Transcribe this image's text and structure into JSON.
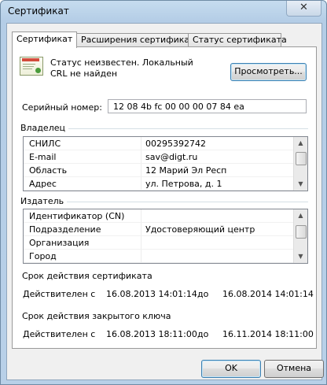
{
  "window": {
    "title": "Сертификат",
    "close_glyph": "✕"
  },
  "tabs": [
    {
      "label": "Сертификат"
    },
    {
      "label": "Расширения сертификата"
    },
    {
      "label": "Статус сертификата"
    }
  ],
  "status": {
    "icon": "certificate-icon",
    "text": "Статус неизвестен. Локальный CRL не найден",
    "view_button": "Просмотреть..."
  },
  "serial": {
    "label": "Серийный номер:",
    "value": "12 08 4b fc 00 00 00 07 84 ea"
  },
  "owner": {
    "label": "Владелец",
    "rows": [
      {
        "key": "СНИЛС",
        "value": "00295392742"
      },
      {
        "key": "E-mail",
        "value": "sav@digt.ru"
      },
      {
        "key": "Область",
        "value": "12 Марий Эл Респ"
      },
      {
        "key": "Адрес",
        "value": "ул. Петрова, д. 1"
      }
    ]
  },
  "issuer": {
    "label": "Издатель",
    "rows": [
      {
        "key": "Идентификатор (CN)",
        "value": ""
      },
      {
        "key": "Подразделение",
        "value": "Удостоверяющий центр"
      },
      {
        "key": "Организация",
        "value": ""
      },
      {
        "key": "Город",
        "value": ""
      }
    ]
  },
  "cert_validity": {
    "label": "Срок действия сертификата",
    "valid_label": "Действителен с",
    "from": "16.08.2013 14:01:14",
    "to_label": "до",
    "to": "16.08.2014 14:01:14"
  },
  "key_validity": {
    "label": "Срок действия закрытого ключа",
    "valid_label": "Действителен с",
    "from": "16.08.2013 18:11:00",
    "to_label": "до",
    "to": "16.11.2014 18:11:00"
  },
  "buttons": {
    "ok": "OK",
    "cancel": "Отмена"
  }
}
